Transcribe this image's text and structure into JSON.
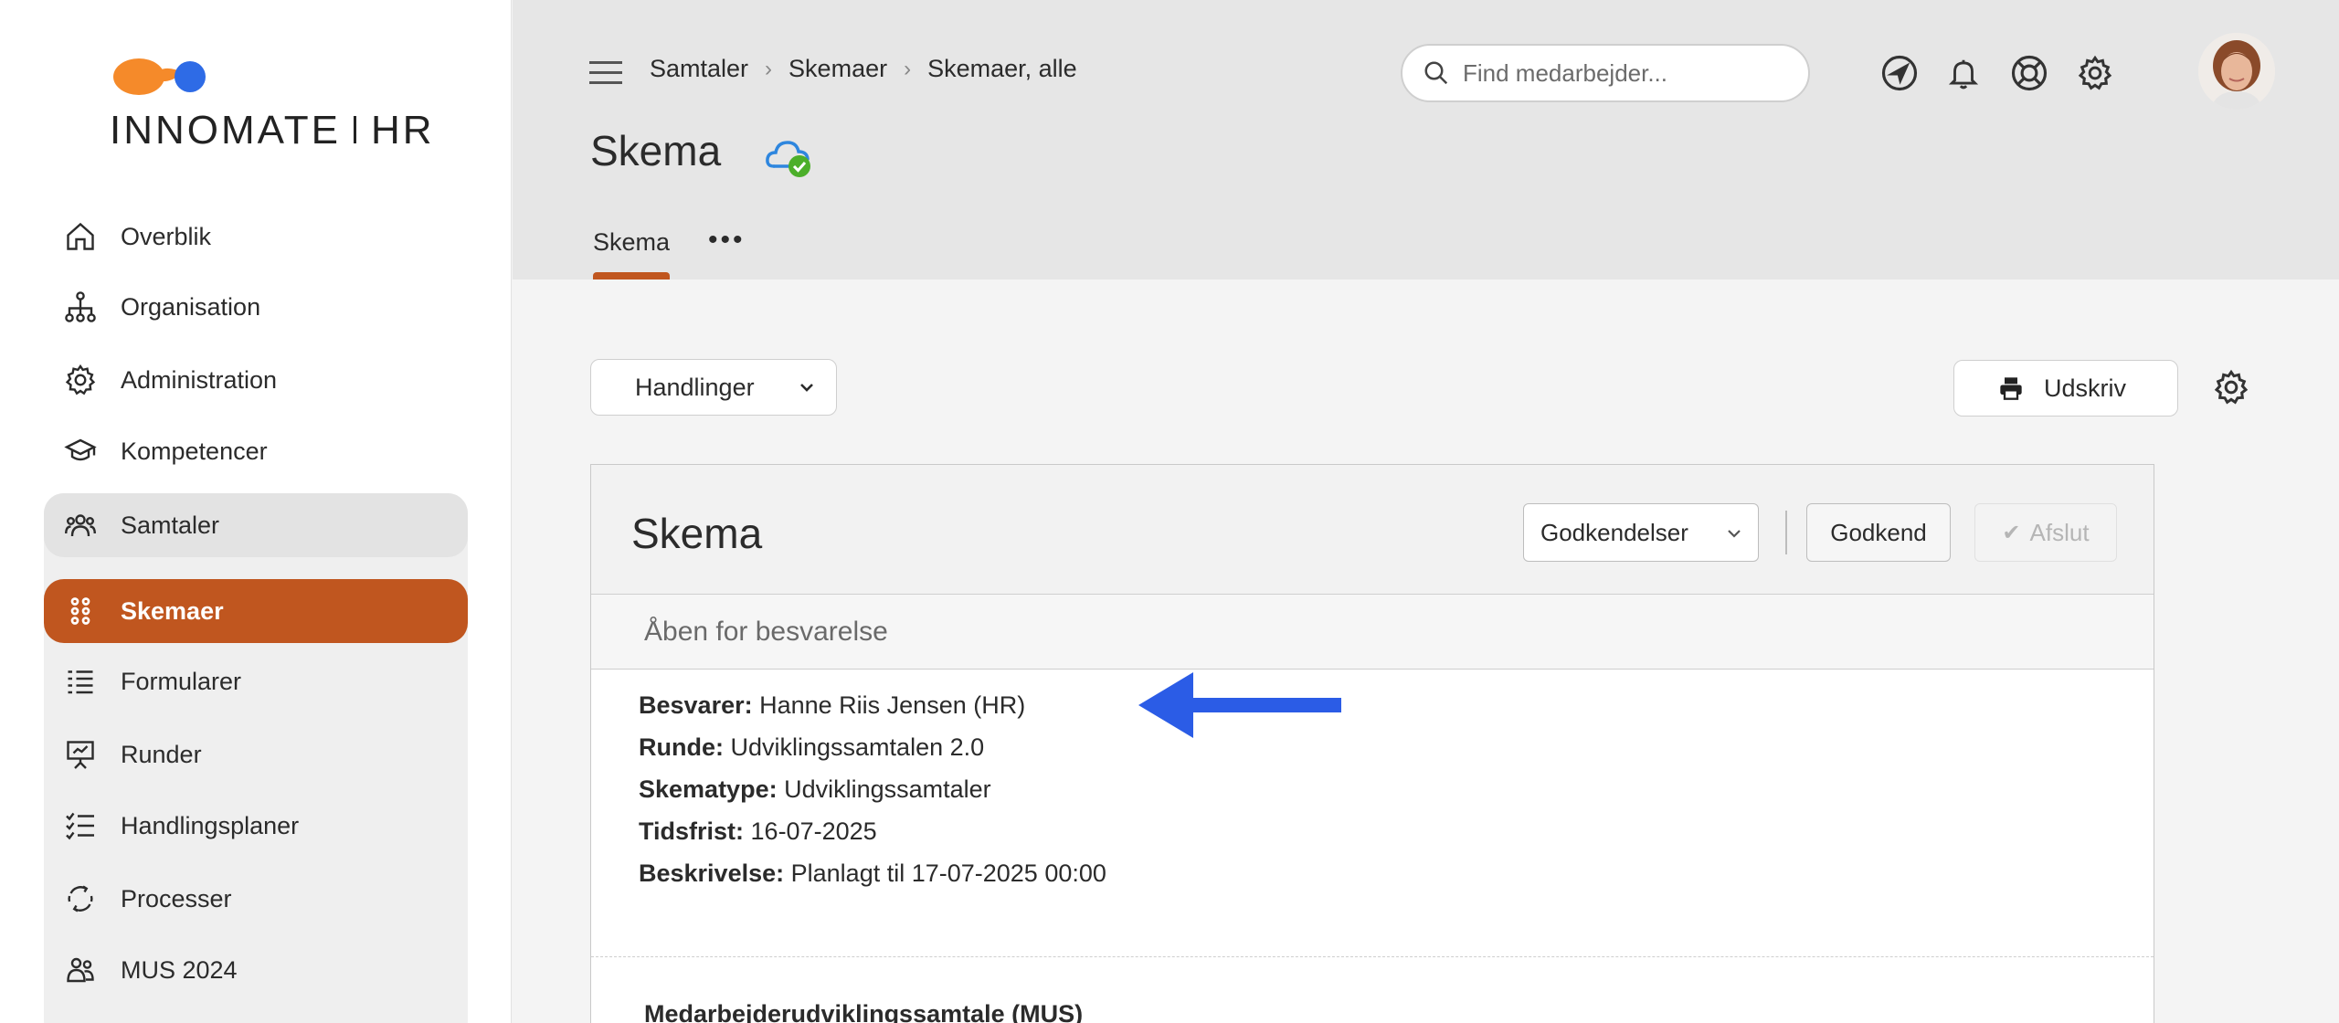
{
  "brand": {
    "name_left": "INNO",
    "name_mid": "MATE",
    "name_right": "HR",
    "accent": "#c0561f",
    "logo_orange": "#f58a2a",
    "logo_blue": "#2e6be6"
  },
  "sidebar": {
    "items": [
      {
        "label": "Overblik",
        "icon": "home-icon"
      },
      {
        "label": "Organisation",
        "icon": "org-chart-icon"
      },
      {
        "label": "Administration",
        "icon": "gear-icon"
      },
      {
        "label": "Kompetencer",
        "icon": "graduation-cap-icon"
      },
      {
        "label": "Samtaler",
        "icon": "people-icon"
      },
      {
        "label": "Skemaer",
        "icon": "grid-dots-icon",
        "active": true
      },
      {
        "label": "Formularer",
        "icon": "list-icon"
      },
      {
        "label": "Runder",
        "icon": "presentation-icon"
      },
      {
        "label": "Handlingsplaner",
        "icon": "checklist-icon"
      },
      {
        "label": "Processer",
        "icon": "cycle-icon"
      },
      {
        "label": "MUS 2024",
        "icon": "people-icon"
      }
    ]
  },
  "header": {
    "breadcrumbs": [
      "Samtaler",
      "Skemaer",
      "Skemaer, alle"
    ],
    "title": "Skema",
    "tabs": [
      "Skema"
    ],
    "search_placeholder": "Find medarbejder..."
  },
  "toolbar": {
    "actions_label": "Handlinger",
    "print_label": "Udskriv"
  },
  "card": {
    "title": "Skema",
    "approvals_label": "Godkendelser",
    "approve_label": "Godkend",
    "close_label": "Afslut",
    "status": "Åben for besvarelse",
    "fields": [
      {
        "key": "Besvarer:",
        "value": "Hanne Riis Jensen (HR)"
      },
      {
        "key": "Runde:",
        "value": "Udviklingssamtalen 2.0"
      },
      {
        "key": "Skematype:",
        "value": "Udviklingssamtaler"
      },
      {
        "key": "Tidsfrist:",
        "value": "16-07-2025"
      },
      {
        "key": "Beskrivelse:",
        "value": "Planlagt til 17-07-2025 00:00"
      }
    ],
    "section_title": "Medarbejderudviklingssamtale (MUS)"
  },
  "annotation": {
    "arrow_color": "#2b5ce6"
  }
}
